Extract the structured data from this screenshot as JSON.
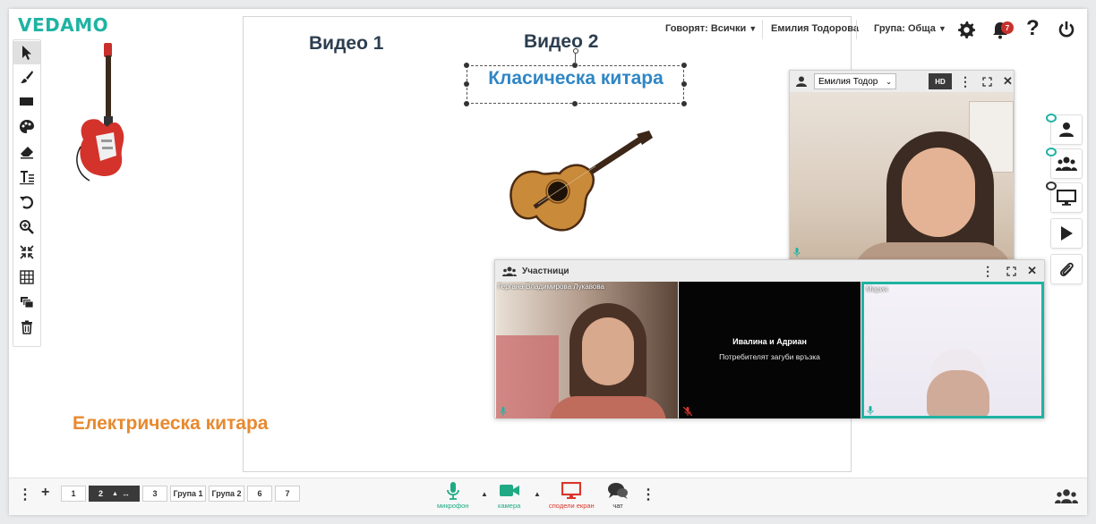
{
  "app": {
    "logo": "VEDAMO"
  },
  "header": {
    "speakers_label": "Говорят: Всички",
    "user_name": "Емилия Тодорова",
    "group_label": "Група: Обща",
    "notification_count": "7"
  },
  "canvas": {
    "video1_label": "Видео 1",
    "video2_label": "Видео 2",
    "classical_label": "Класическа китара",
    "electric_label": "Електрическа китара"
  },
  "video_panel": {
    "user_select": "Емилия Тодор",
    "hd_label": "HD"
  },
  "participants": {
    "title": "Участници",
    "tiles": [
      {
        "name": "Гергана Владимирова Лукавова",
        "status": ""
      },
      {
        "name": "Ивалина и Адриан",
        "status": "Потребителят загуби връзка"
      },
      {
        "name": "Мария",
        "status": ""
      }
    ]
  },
  "pages": [
    "1",
    "2",
    "3",
    "Група 1",
    "Група 2",
    "6",
    "7"
  ],
  "bottom_controls": {
    "mic_label": "микрофон",
    "camera_label": "камера",
    "share_label": "сподели екран",
    "chat_label": "чат"
  },
  "colors": {
    "accent": "#1fb3a3",
    "title_dark": "#2c3e50",
    "classical_blue": "#2f86c5",
    "electric_orange": "#e8892f",
    "share_red": "#d9362c",
    "mic_green": "#1faa83"
  }
}
